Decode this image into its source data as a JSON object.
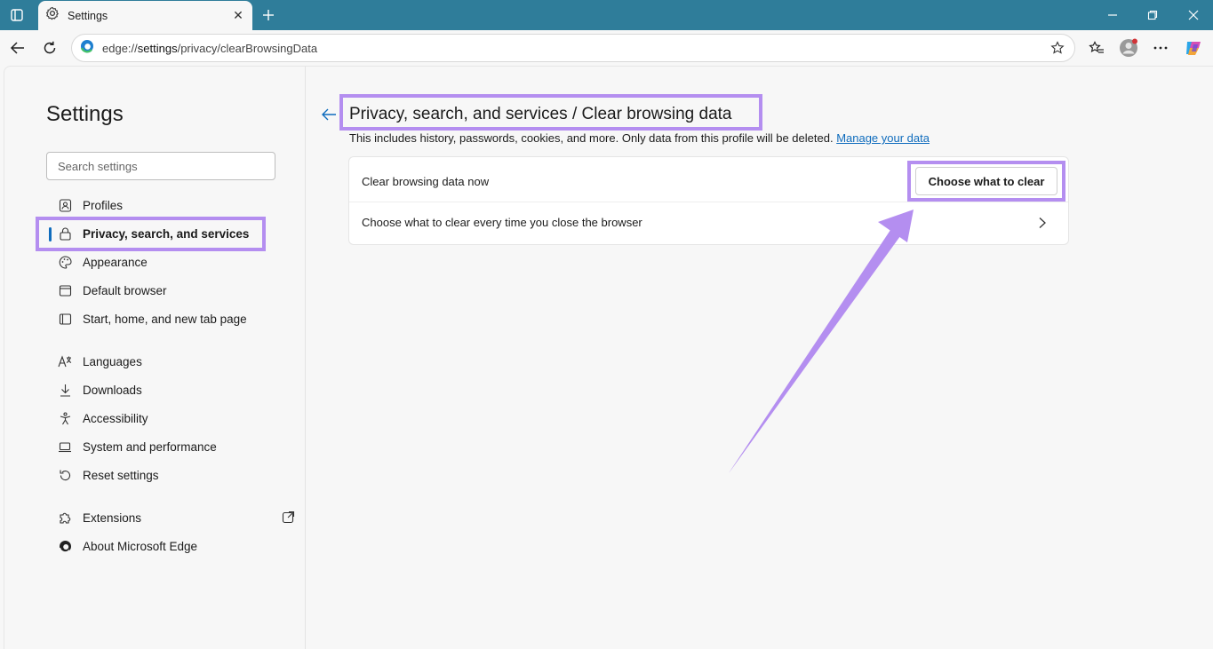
{
  "browser": {
    "tab": {
      "title": "Settings",
      "close_glyph": "✕",
      "icon": "gear-icon"
    },
    "address": {
      "scheme": "edge://",
      "host": "settings",
      "path": "/privacy/clearBrowsingData"
    }
  },
  "sidebar": {
    "title": "Settings",
    "search_placeholder": "Search settings",
    "items": [
      {
        "label": "Profiles",
        "icon": "profile-card-icon"
      },
      {
        "label": "Privacy, search, and services",
        "icon": "lock-icon",
        "active": true
      },
      {
        "label": "Appearance",
        "icon": "palette-icon"
      },
      {
        "label": "Default browser",
        "icon": "browser-window-icon"
      },
      {
        "label": "Start, home, and new tab page",
        "icon": "home-page-icon"
      },
      {
        "label": "Languages",
        "icon": "languages-icon"
      },
      {
        "label": "Downloads",
        "icon": "download-icon"
      },
      {
        "label": "Accessibility",
        "icon": "accessibility-icon"
      },
      {
        "label": "System and performance",
        "icon": "laptop-icon"
      },
      {
        "label": "Reset settings",
        "icon": "reset-icon"
      },
      {
        "label": "Extensions",
        "icon": "puzzle-icon"
      },
      {
        "label": "About Microsoft Edge",
        "icon": "edge-logo-icon"
      }
    ]
  },
  "main": {
    "heading": "Privacy, search, and services / Clear browsing data",
    "description": "This includes history, passwords, cookies, and more. Only data from this profile will be deleted.",
    "manage_link": "Manage your data",
    "clear_now_label": "Clear browsing data now",
    "choose_button": "Choose what to clear",
    "on_close_label": "Choose what to clear every time you close the browser"
  },
  "colors": {
    "titlebar": "#2f7d9a",
    "accent": "#0f6cbd",
    "annotation": "#b48ef0"
  }
}
